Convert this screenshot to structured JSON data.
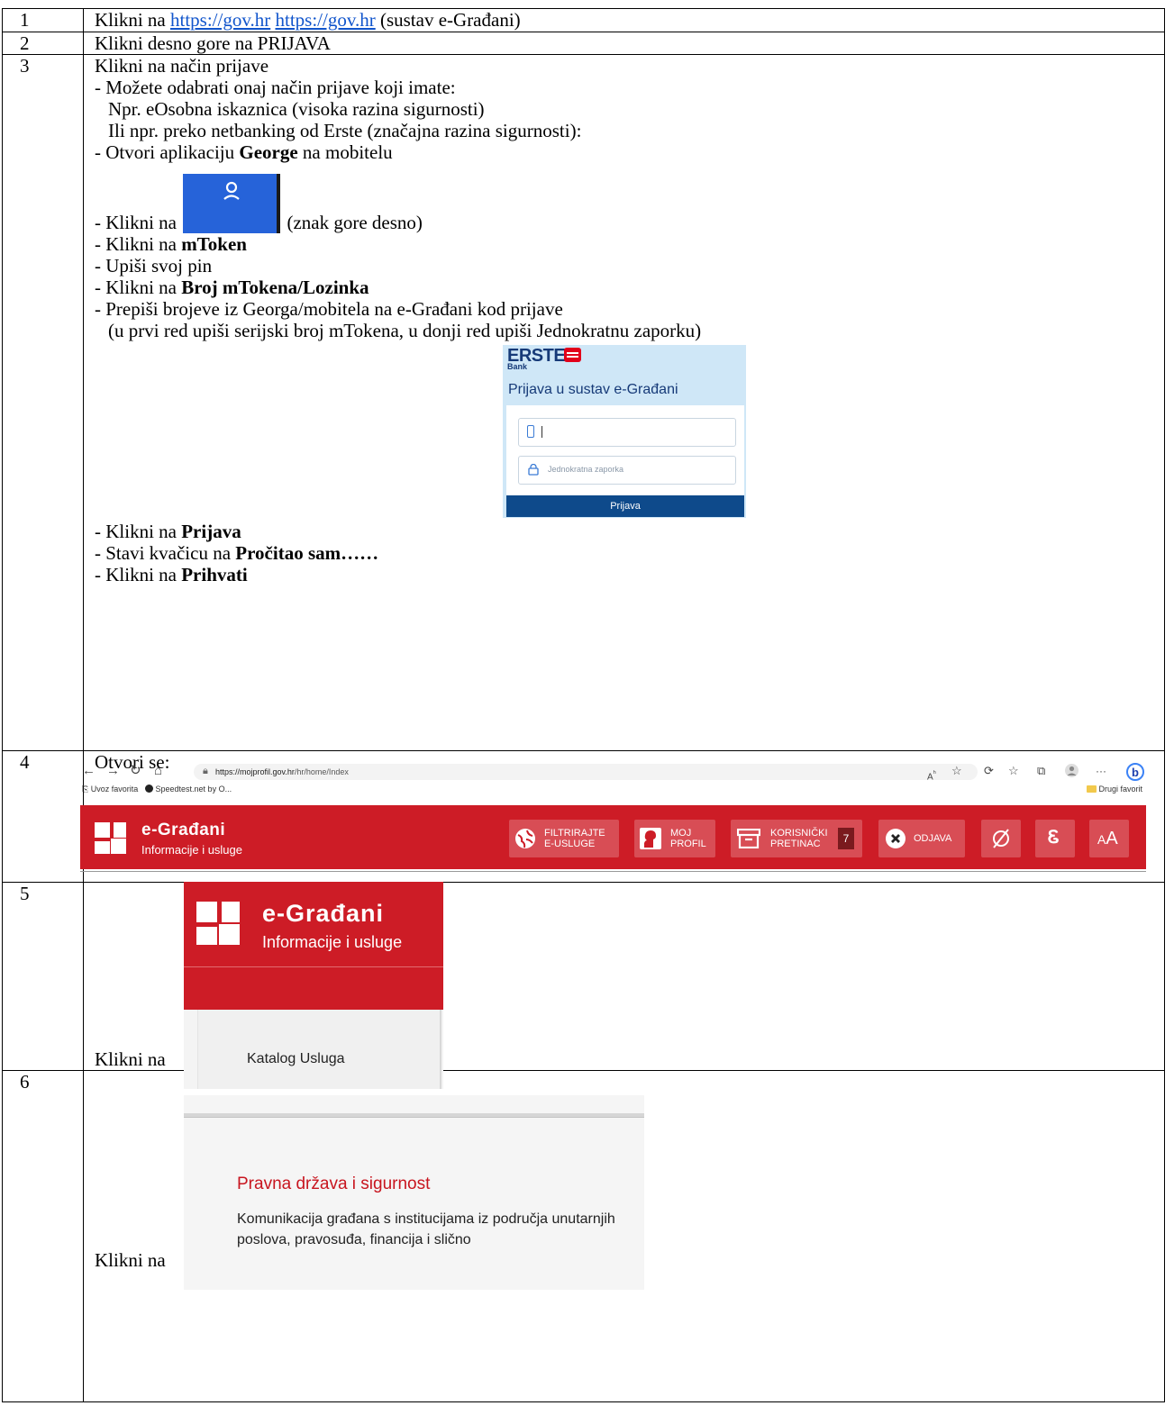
{
  "rows": [
    {
      "num": "1"
    },
    {
      "num": "2"
    },
    {
      "num": "3"
    },
    {
      "num": "4"
    },
    {
      "num": "5"
    },
    {
      "num": "6"
    }
  ],
  "step1": {
    "pre": "Klikni na ",
    "link1": "https://gov.hr",
    "link2": "https://gov.hr",
    "post": " (sustav e-Građani)"
  },
  "step2": {
    "text": "Klikni desno gore na PRIJAVA"
  },
  "step3": {
    "l1": "Klikni na način prijave",
    "l2": "- Možete odabrati onaj način prijave koji imate:",
    "l3": "Npr. eOsobna iskaznica (visoka razina sigurnosti)",
    "l4": "Ili npr. preko netbanking od Erste (značajna razina sigurnosti):",
    "l5_pre": "- Otvori aplikaciju ",
    "l5_bold": "George",
    "l5_post": " na mobitelu",
    "l6_pre": "- Klikni na ",
    "l6_post": " (znak gore desno)",
    "l7_pre": "- Klikni na ",
    "l7_bold": "mToken",
    "l8": "- Upiši svoj pin",
    "l9_pre": "- Klikni na ",
    "l9_bold": "Broj mTokena/Lozinka",
    "l10": "- Prepiši brojeve iz Georga/mobitela na e-Građani kod prijave",
    "l11": "(u prvi red upiši serijski broj mTokena, u donji red upiši Jednokratnu zaporku)",
    "l12_pre": "- Klikni na ",
    "l12_bold": "Prijava",
    "l13_pre": "- Stavi kvačicu na ",
    "l13_bold": "Pročitao sam……",
    "l14_pre": "- Klikni na ",
    "l14_bold": "Prihvati"
  },
  "erste": {
    "logo": "ERSTE",
    "bank": "Bank",
    "title": "Prijava u sustav e-Građani",
    "otp_placeholder": "Jednokratna zaporka",
    "button": "Prijava"
  },
  "step4": {
    "text": "Otvori se:",
    "browser": {
      "url_host": "https://mojprofil.gov.hr",
      "url_path": "/hr/home/Index",
      "bookmark1": "Uvoz favorita",
      "bookmark2": "Speedtest.net by O...",
      "bookmark3": "Drugi favorit"
    },
    "banner": {
      "title": "e-Građani",
      "subtitle": "Informacije i usluge",
      "filter": [
        "FILTRIRAJTE",
        "E-USLUGE"
      ],
      "profile": [
        "MOJ",
        "PROFIL"
      ],
      "inbox": [
        "KORISNIČKI",
        "PRETINAC"
      ],
      "inbox_count": "7",
      "logout": "ODJAVA",
      "dyslexic": "Ꮛ",
      "text_size": "AA"
    }
  },
  "step5": {
    "text": "Klikni na",
    "title": "e-Građani",
    "subtitle": "Informacije i usluge",
    "catalog": "Katalog Usluga"
  },
  "step6": {
    "text": "Klikni na",
    "title": "Pravna država i sigurnost",
    "desc": "Komunikacija građana s institucijama iz područja unutarnjih poslova, pravosuđa, financija i slično"
  },
  "colors": {
    "brand_red": "#cd1c26",
    "erste_blue": "#0e4a8b",
    "erste_bg": "#cfe7f7",
    "avatar_blue": "#2663d9",
    "link": "#1155cc"
  }
}
